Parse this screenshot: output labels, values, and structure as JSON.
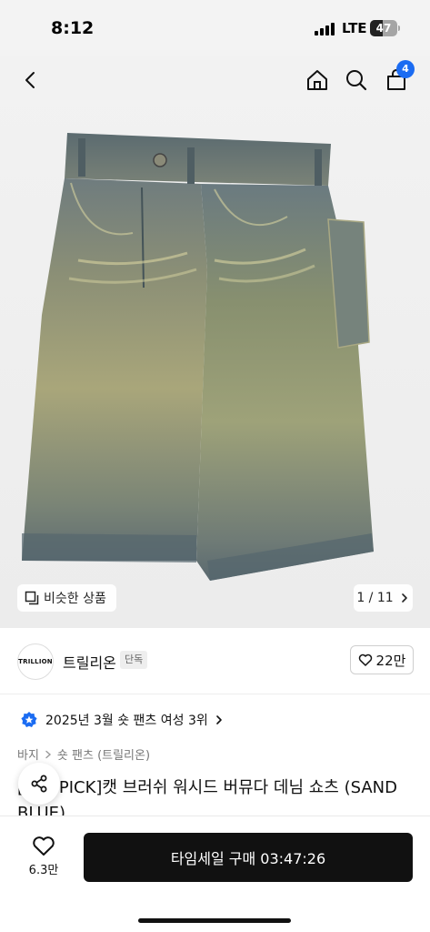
{
  "status_bar": {
    "time": "8:12",
    "network": "LTE",
    "battery": "47",
    "battery_level": 0.47
  },
  "nav": {
    "back_icon": "chevron-left-icon",
    "home_icon": "home-icon",
    "search_icon": "search-icon",
    "cart_icon": "shopping-bag-icon",
    "cart_count": "4"
  },
  "gallery": {
    "similar_label": "비슷한 상품",
    "page_current": "1",
    "page_total": "11",
    "page_indicator": "1 / 11"
  },
  "brand": {
    "logo_text": "TRILLION",
    "name": "트릴리온",
    "tag": "단독",
    "like_count": "22만"
  },
  "ranking": {
    "text": "2025년 3월 숏 팬츠 여성 3위"
  },
  "breadcrumb": {
    "category": "바지",
    "subcategory": "숏 팬츠 (트릴리온)"
  },
  "product": {
    "title": "[송이 PICK]캣 브러쉬 워시드 버뮤다 데님 쇼츠 (SAND BLUE)"
  },
  "bottom_bar": {
    "like_count": "6.3만",
    "buy_label": "타임세일 구매 03:47:26"
  },
  "colors": {
    "accent_blue": "#1b6cf2",
    "buy_button": "#111111"
  }
}
